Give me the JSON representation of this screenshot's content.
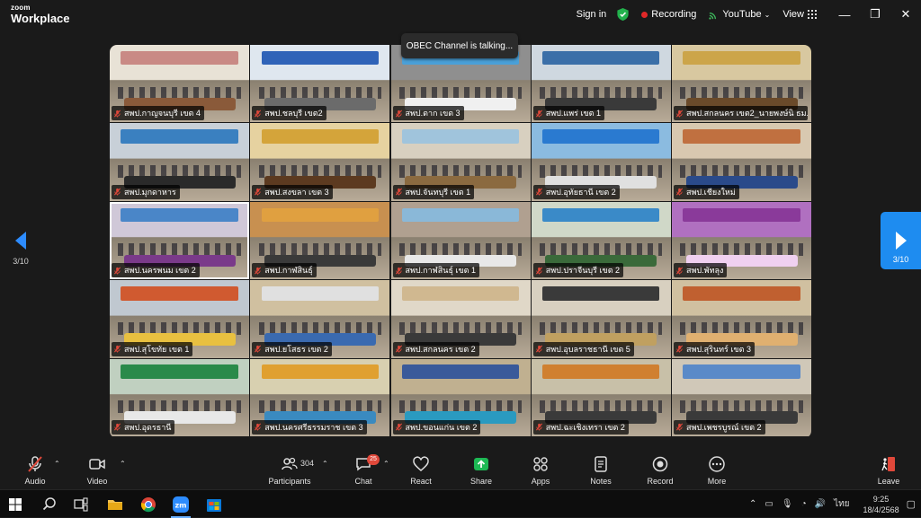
{
  "app": {
    "brand_small": "zoom",
    "brand_large": "Workplace"
  },
  "titlebar": {
    "signin": "Sign in",
    "recording": "Recording",
    "livestream": "YouTube",
    "view": "View",
    "minimize": "—",
    "restore": "❐",
    "close": "✕"
  },
  "talking": "OBEC Channel is talking...",
  "pagination": {
    "left": "3/10",
    "right": "3/10"
  },
  "participants": [
    {
      "name": "สพป.กาญจนบุรี เขต 4",
      "colors": [
        "#c98a85",
        "#8a5a3a",
        "#e8e2d6"
      ]
    },
    {
      "name": "สพป.ชลบุรี เขต2",
      "colors": [
        "#2f63b8",
        "#6b6b6b",
        "#dfe7ef"
      ]
    },
    {
      "name": "สพป.ตาก เขต 3",
      "colors": [
        "#4aa0d8",
        "#f0f0f0",
        "#8f8f8f"
      ]
    },
    {
      "name": "สพป.แพร่ เขต 1",
      "colors": [
        "#3b6fa8",
        "#3a3a3a",
        "#cfd8e0"
      ]
    },
    {
      "name": "สพป.สกลนคร เขต2_นายพงษ์นิ ธม...",
      "colors": [
        "#cca54a",
        "#6a4a2a",
        "#d8c8a0"
      ]
    },
    {
      "name": "สพป.มุกดาหาร",
      "colors": [
        "#3a80c0",
        "#2a2a2a",
        "#c8d0d8"
      ]
    },
    {
      "name": "สพป.สงขลา เขต 3",
      "colors": [
        "#d4a43a",
        "#5c3a20",
        "#e6d2a0"
      ]
    },
    {
      "name": "สพป.จันทบุรี เขต 1",
      "colors": [
        "#a0c4dc",
        "#8b6a40",
        "#d8d0c0"
      ]
    },
    {
      "name": "สพป.อุทัยธานี เขต 2",
      "colors": [
        "#2a7ad0",
        "#e0e0e0",
        "#8bbbe0"
      ]
    },
    {
      "name": "สพป.เชียงใหม่",
      "colors": [
        "#c07040",
        "#2a4a8a",
        "#d8c8b0"
      ]
    },
    {
      "name": "สพป.นครพนม เขต 2",
      "colors": [
        "#4a86c8",
        "#7a3a8a",
        "#d0c8d8"
      ]
    },
    {
      "name": "สพป.กาฬสินธุ์",
      "colors": [
        "#e0a040",
        "#3a3a3a",
        "#c89050"
      ]
    },
    {
      "name": "สพป.กาฬสินธุ์ เขต 1",
      "colors": [
        "#8ab8d8",
        "#e8e8e8",
        "#b0a090"
      ]
    },
    {
      "name": "สพป.ปราจีนบุรี เขต 2",
      "colors": [
        "#3a8ac8",
        "#3a6a3a",
        "#d0d8c8"
      ]
    },
    {
      "name": "สพป.พัทลุง",
      "colors": [
        "#8a3a9a",
        "#f0d0f0",
        "#b070c0"
      ]
    },
    {
      "name": "สพป.สุโขทัย เขต 1",
      "colors": [
        "#d05a30",
        "#e8c040",
        "#c0c8d0"
      ]
    },
    {
      "name": "สพป.ยโสธร เขต 2",
      "colors": [
        "#e0e0e0",
        "#3a6ab0",
        "#d0c0a0"
      ]
    },
    {
      "name": "สพป.สกลนคร เขต 2",
      "colors": [
        "#d0b890",
        "#3a3a3a",
        "#e0d8c8"
      ]
    },
    {
      "name": "สพป.อุบลราชธานี เขต 5",
      "colors": [
        "#3a3a3a",
        "#c0a060",
        "#d8d0c0"
      ]
    },
    {
      "name": "สพป.สุรินทร์ เขต 3",
      "colors": [
        "#c06030",
        "#e0b070",
        "#d0c0a0"
      ]
    },
    {
      "name": "สพป.อุดรธานี",
      "colors": [
        "#2a8a4a",
        "#e8e8e8",
        "#c0d0c0"
      ]
    },
    {
      "name": "สพป.นครศรีธรรมราช เขต 3",
      "colors": [
        "#e0a030",
        "#3a8ac0",
        "#d8d0b0"
      ]
    },
    {
      "name": "สพป.ขอนแก่น เขต 2",
      "colors": [
        "#3a5a9a",
        "#2a9ac0",
        "#c0b090"
      ]
    },
    {
      "name": "สพป.ฉะเชิงเทรา เขต 2",
      "colors": [
        "#d08030",
        "#3a3a3a",
        "#c8c0a8"
      ]
    },
    {
      "name": "สพป.เพชรบูรณ์ เขต 2",
      "colors": [
        "#5a8ac8",
        "#3a3a3a",
        "#d0c8b8"
      ]
    }
  ],
  "toolbar": {
    "audio": "Audio",
    "video": "Video",
    "participants": "Participants",
    "participants_count": "304",
    "chat": "Chat",
    "chat_badge": "25",
    "react": "React",
    "share": "Share",
    "apps": "Apps",
    "notes": "Notes",
    "record": "Record",
    "more": "More",
    "leave": "Leave"
  },
  "taskbar": {
    "language": "ไทย",
    "time": "9:25",
    "date": "18/4/2568"
  },
  "colors": {
    "accent": "#2d8cff",
    "share_green": "#1db954",
    "record_red": "#e02828",
    "leave_red": "#e0483a"
  }
}
